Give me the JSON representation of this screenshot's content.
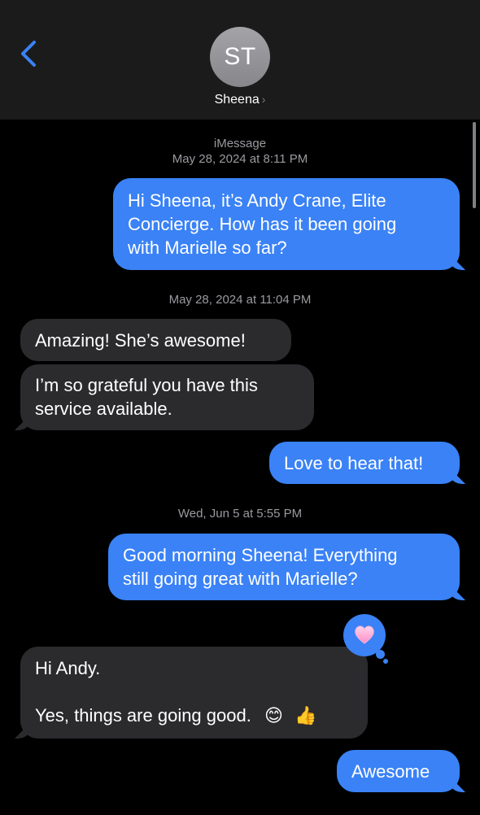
{
  "header": {
    "avatar_initials": "ST",
    "contact_name": "Sheena",
    "chevron": "›"
  },
  "thread": {
    "service_label": "iMessage",
    "timestamp_1": "May 28, 2024 at 8:11 PM",
    "timestamp_2": "May 28, 2024 at 11:04 PM",
    "timestamp_3": "Wed, Jun 5 at 5:55 PM"
  },
  "messages": [
    {
      "from": "me",
      "lines": [
        "Hi Sheena, it’s Andy Crane, Elite",
        "Concierge. How has it been going",
        "with Marielle so far?"
      ]
    },
    {
      "from": "them",
      "lines": [
        "Amazing! She’s awesome!"
      ]
    },
    {
      "from": "them",
      "lines": [
        "I’m so grateful you have this",
        "service available."
      ]
    },
    {
      "from": "me",
      "lines": [
        "Love to hear that!"
      ]
    },
    {
      "from": "me",
      "lines": [
        "Good morning Sheena! Everything",
        "still going great with Marielle?"
      ]
    },
    {
      "from": "them",
      "lines": [
        "Hi Andy.",
        "",
        "Yes, things are going good."
      ],
      "emojis": [
        "😊",
        "👍"
      ]
    },
    {
      "from": "me",
      "lines": [
        "Awesome"
      ]
    }
  ],
  "tapback": {
    "reaction": "heart",
    "icon": "pink-heart-icon",
    "color": "#ffb3d9"
  },
  "colors": {
    "outgoing": "#3a82f6",
    "incoming": "#2b2b2e",
    "accent": "#3a82f6",
    "header_bg": "#1b1b1b"
  }
}
